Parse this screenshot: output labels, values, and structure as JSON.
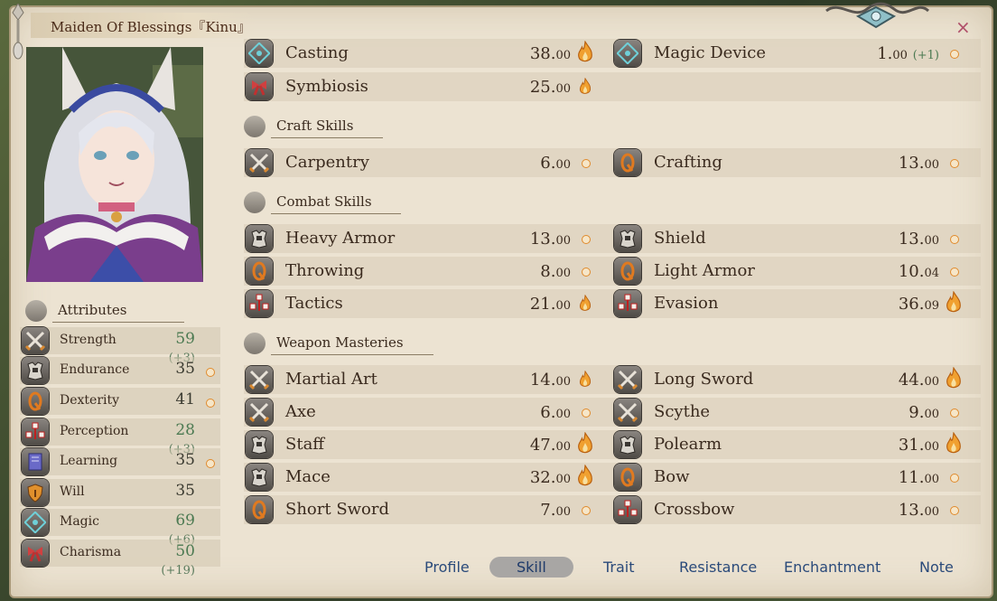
{
  "window": {
    "title": "Maiden Of Blessings『Kinu』",
    "close": "×"
  },
  "attributes": {
    "heading": "Attributes",
    "items": [
      {
        "label": "Strength",
        "value": "59",
        "bonus": "(+3)",
        "icon": "crossed-swords-icon",
        "potential": "none"
      },
      {
        "label": "Endurance",
        "value": "35",
        "bonus": "",
        "icon": "armor-icon",
        "potential": "dot"
      },
      {
        "label": "Dexterity",
        "value": "41",
        "bonus": "",
        "icon": "dagger-icon",
        "potential": "dot"
      },
      {
        "label": "Perception",
        "value": "28",
        "bonus": "(+3)",
        "icon": "crosshair-icon",
        "potential": "none"
      },
      {
        "label": "Learning",
        "value": "35",
        "bonus": "",
        "icon": "book-icon",
        "potential": "dot"
      },
      {
        "label": "Will",
        "value": "35",
        "bonus": "",
        "icon": "shield-heart-icon",
        "potential": "none"
      },
      {
        "label": "Magic",
        "value": "69",
        "bonus": "(+6)",
        "icon": "rune-icon",
        "potential": "none"
      },
      {
        "label": "Charisma",
        "value": "50",
        "bonus": "(+19)",
        "icon": "ribbon-icon",
        "potential": "none"
      }
    ]
  },
  "skills": {
    "top": [
      {
        "left": {
          "label": "Casting",
          "value": "38.",
          "decimal": "00",
          "icon": "rune-icon",
          "potential": "flame-big"
        },
        "right": {
          "label": "Magic Device",
          "value": "1.",
          "decimal": "00",
          "bonus": "(+1)",
          "icon": "rune-icon",
          "potential": "dot"
        }
      },
      {
        "left": {
          "label": "Symbiosis",
          "value": "25.",
          "decimal": "00",
          "icon": "ribbon-icon",
          "potential": "flame"
        }
      }
    ],
    "craft_heading": "Craft Skills",
    "craft": [
      {
        "left": {
          "label": "Carpentry",
          "value": "6.",
          "decimal": "00",
          "icon": "crossed-swords-icon",
          "potential": "dot"
        },
        "right": {
          "label": "Crafting",
          "value": "13.",
          "decimal": "00",
          "icon": "dagger-icon",
          "potential": "dot"
        }
      }
    ],
    "combat_heading": "Combat Skills",
    "combat": [
      {
        "left": {
          "label": "Heavy Armor",
          "value": "13.",
          "decimal": "00",
          "icon": "armor-icon",
          "potential": "dot"
        },
        "right": {
          "label": "Shield",
          "value": "13.",
          "decimal": "00",
          "icon": "armor-icon",
          "potential": "dot"
        }
      },
      {
        "left": {
          "label": "Throwing",
          "value": "8.",
          "decimal": "00",
          "icon": "dagger-icon",
          "potential": "dot"
        },
        "right": {
          "label": "Light Armor",
          "value": "10.",
          "decimal": "04",
          "icon": "dagger-icon",
          "potential": "dot"
        }
      },
      {
        "left": {
          "label": "Tactics",
          "value": "21.",
          "decimal": "00",
          "icon": "crosshair-icon",
          "potential": "flame"
        },
        "right": {
          "label": "Evasion",
          "value": "36.",
          "decimal": "09",
          "icon": "crosshair-icon",
          "potential": "flame-big"
        }
      }
    ],
    "weapon_heading": "Weapon Masteries",
    "weapon": [
      {
        "left": {
          "label": "Martial Art",
          "value": "14.",
          "decimal": "00",
          "icon": "crossed-swords-icon",
          "potential": "flame"
        },
        "right": {
          "label": "Long Sword",
          "value": "44.",
          "decimal": "00",
          "icon": "crossed-swords-icon",
          "potential": "flame-big"
        }
      },
      {
        "left": {
          "label": "Axe",
          "value": "6.",
          "decimal": "00",
          "icon": "crossed-swords-icon",
          "potential": "dot"
        },
        "right": {
          "label": "Scythe",
          "value": "9.",
          "decimal": "00",
          "icon": "crossed-swords-icon",
          "potential": "dot"
        }
      },
      {
        "left": {
          "label": "Staff",
          "value": "47.",
          "decimal": "00",
          "icon": "armor-icon",
          "potential": "flame-big"
        },
        "right": {
          "label": "Polearm",
          "value": "31.",
          "decimal": "00",
          "icon": "armor-icon",
          "potential": "flame-big"
        }
      },
      {
        "left": {
          "label": "Mace",
          "value": "32.",
          "decimal": "00",
          "icon": "armor-icon",
          "potential": "flame-big"
        },
        "right": {
          "label": "Bow",
          "value": "11.",
          "decimal": "00",
          "icon": "dagger-icon",
          "potential": "dot"
        }
      },
      {
        "left": {
          "label": "Short Sword",
          "value": "7.",
          "decimal": "00",
          "icon": "dagger-icon",
          "potential": "dot"
        },
        "right": {
          "label": "Crossbow",
          "value": "13.",
          "decimal": "00",
          "icon": "crosshair-icon",
          "potential": "dot"
        }
      }
    ]
  },
  "tabs": [
    {
      "label": "Profile",
      "active": false
    },
    {
      "label": "Skill",
      "active": true
    },
    {
      "label": "Trait",
      "active": false
    },
    {
      "label": "Resistance",
      "active": false
    },
    {
      "label": "Enchantment",
      "active": false
    },
    {
      "label": "Note",
      "active": false
    }
  ],
  "colors": {
    "parchment": "#ece3d2",
    "bonus_green": "#4c7a52",
    "tab_blue": "#2a4a7a",
    "flame_orange": "#f0a030"
  }
}
